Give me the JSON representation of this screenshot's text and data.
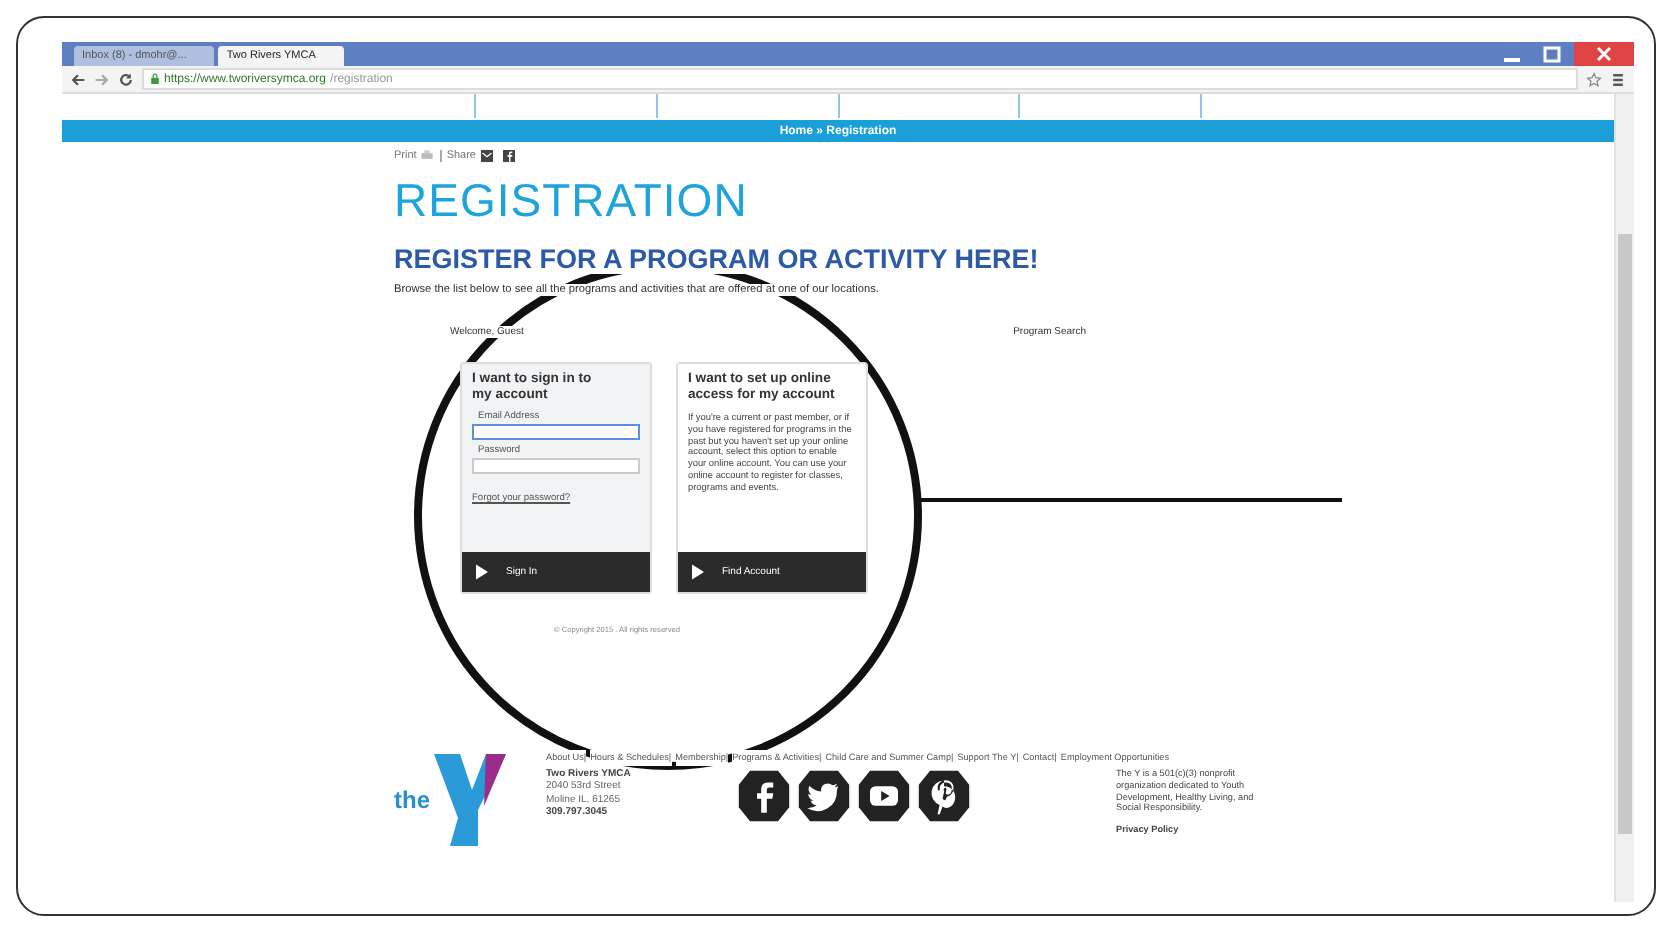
{
  "browser": {
    "tabs": [
      {
        "title": "Inbox (8) - dmohr@...",
        "selected": false
      },
      {
        "title": "Two Rivers YMCA",
        "selected": true
      }
    ],
    "url_host": "https://www.tworiversymca.org",
    "url_path": "/registration"
  },
  "breadcrumb": "Home » Registration",
  "share_bar": {
    "print": "Print",
    "share": "Share"
  },
  "title": "REGISTRATION",
  "subtitle": "REGISTER FOR A PROGRAM OR ACTIVITY HERE!",
  "intro": "Browse the list below to see all the programs and activities that are offered at one of our locations.",
  "welcome": "Welcome, Guest",
  "program_search": "Program Search",
  "cards": [
    {
      "kind": "signin",
      "heading": "I want to sign in to my account",
      "fields": [
        {
          "label": "Email Address",
          "focused": true
        },
        {
          "label": "Password",
          "focused": false
        }
      ],
      "link": "Forgot your password?",
      "button": "Sign In"
    },
    {
      "kind": "info",
      "heading": "I want to set up online access for my account",
      "body": "If you're a current or past member, or if you have registered for programs in the past but you haven't set up your online account, select this option to enable your online account. You can use your online account to register for classes, programs and events.",
      "button": "Find Account"
    }
  ],
  "copyright": "© Copyright 2015 . All rights reserved",
  "footer": {
    "logo_text": "the",
    "links": [
      "About Us|",
      "Hours & Schedules|",
      "Membership|",
      "Programs & Activities|",
      "Child Care and Summer Camp|",
      "Support The Y|",
      "Contact|",
      "Employment Opportunities"
    ],
    "address": [
      "Two Rivers YMCA",
      "2040 53rd Street",
      "Moline IL, 61265",
      "309.797.3045"
    ],
    "mission": "The Y is a 501(c)(3) nonprofit organization dedicated to Youth Development, Healthy Living, and Social Responsibility.",
    "privacy": "Privacy Policy"
  }
}
